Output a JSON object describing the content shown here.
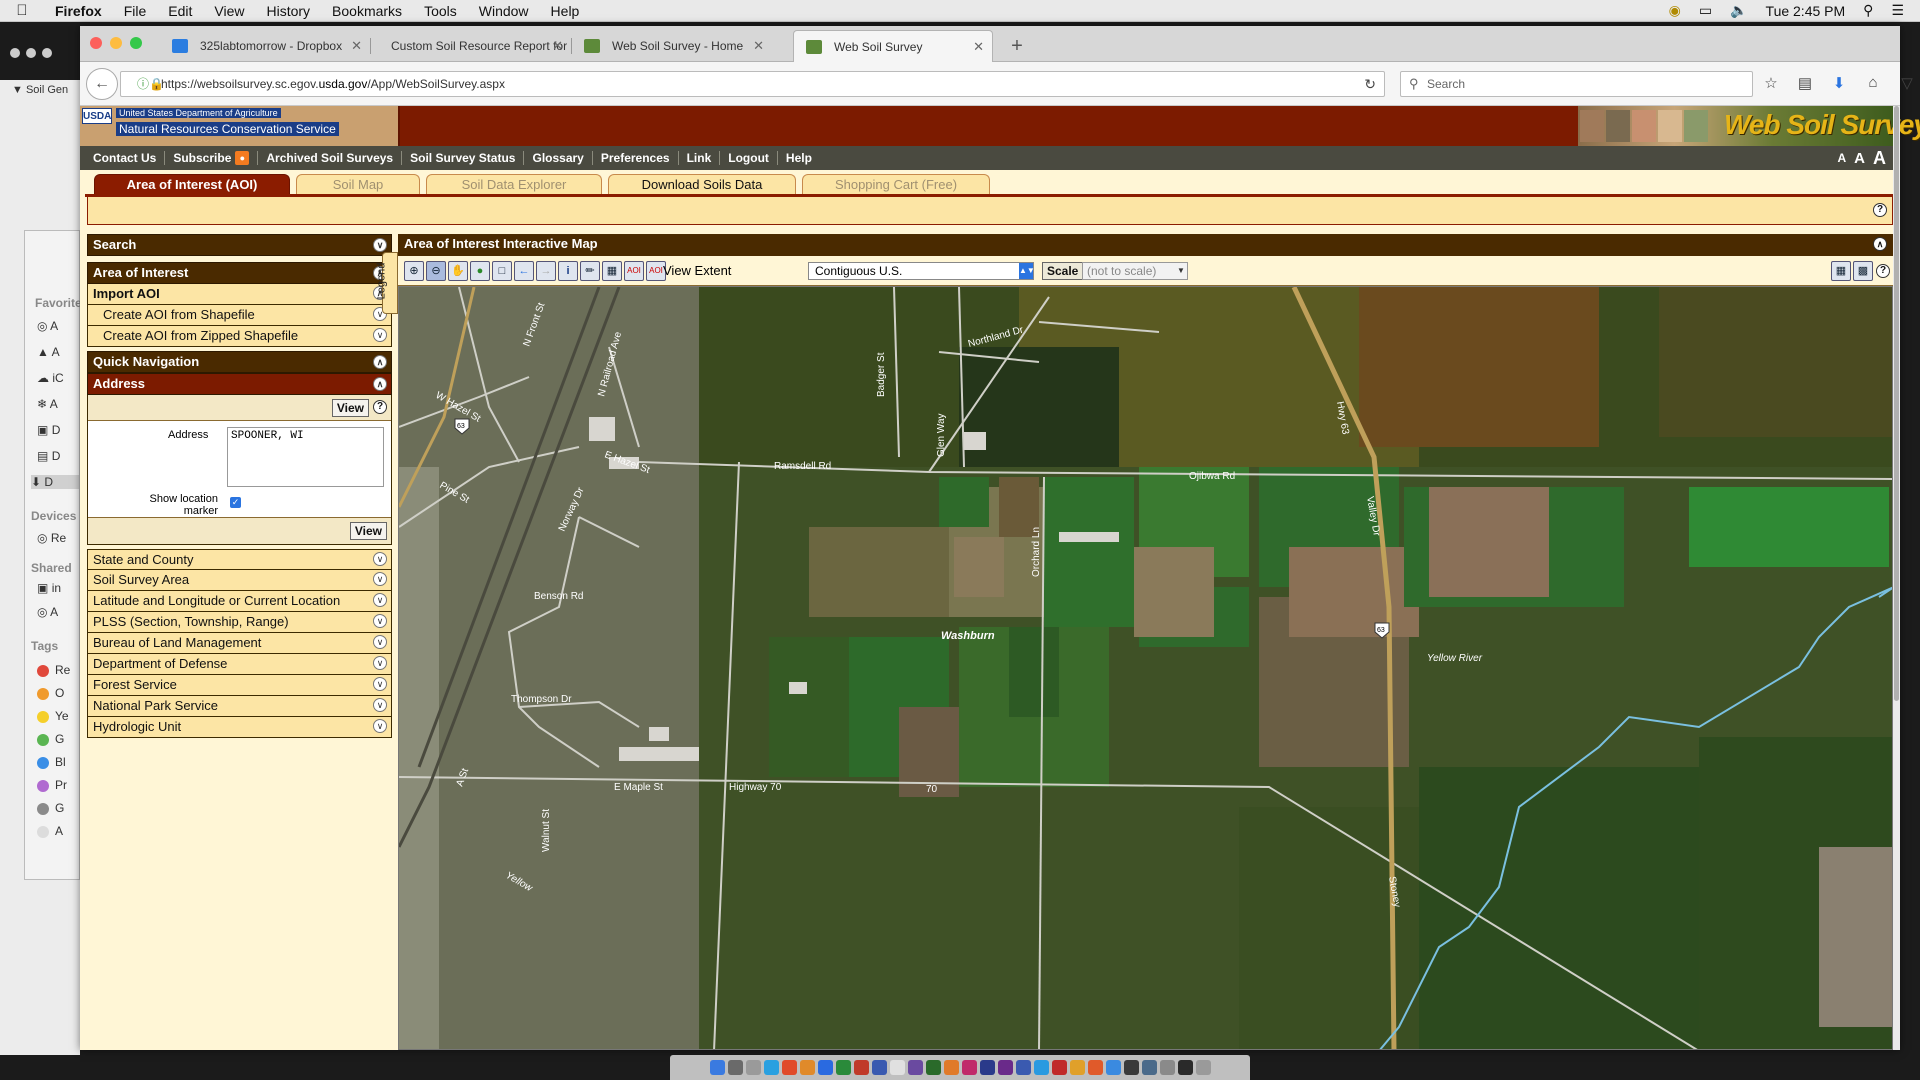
{
  "menubar": {
    "app": "Firefox",
    "items": [
      "File",
      "Edit",
      "View",
      "History",
      "Bookmarks",
      "Tools",
      "Window",
      "Help"
    ],
    "clock": "Tue 2:45 PM"
  },
  "background_window": {
    "title": "Soil Gen",
    "sidebar": {
      "favorites_label": "Favorite",
      "devices_label": "Devices",
      "shared_label": "Shared",
      "tags_label": "Tags",
      "favorites": [
        "A",
        "A",
        "iC",
        "A",
        "D",
        "D",
        "D"
      ],
      "devices": [
        "Re"
      ],
      "shared": [
        "in",
        "A"
      ],
      "tags": [
        {
          "label": "Re",
          "color": "#e0483b"
        },
        {
          "label": "O",
          "color": "#f09a2c"
        },
        {
          "label": "Ye",
          "color": "#f5cf2a"
        },
        {
          "label": "G",
          "color": "#5ab552"
        },
        {
          "label": "Bl",
          "color": "#3a8ee6"
        },
        {
          "label": "Pr",
          "color": "#b06ad0"
        },
        {
          "label": "G",
          "color": "#8a8a8a"
        },
        {
          "label": "A",
          "color": "#dcdcdc"
        }
      ]
    }
  },
  "browser": {
    "tabs": [
      {
        "label": "325labtomorrow - Dropbox",
        "icon": "dropbox-icon",
        "active": false
      },
      {
        "label": "Custom Soil Resource Report for",
        "icon": "none",
        "active": false
      },
      {
        "label": "Web Soil Survey - Home",
        "icon": "usda-icon",
        "active": false
      },
      {
        "label": "Web Soil Survey",
        "icon": "usda-icon",
        "active": true
      }
    ],
    "url_prefix": "https://websoilsurvey.sc.egov.",
    "url_domain": "usda.gov",
    "url_suffix": "/App/WebSoilSurvey.aspx",
    "search_placeholder": "Search"
  },
  "site": {
    "usda_badge": "USDA",
    "agency_line1": "United States Department of Agriculture",
    "agency_line2": "Natural Resources Conservation Service",
    "banner_title": "Web Soil Survey",
    "topnav": [
      "Contact Us",
      "Subscribe",
      "Archived Soil Surveys",
      "Soil Survey Status",
      "Glossary",
      "Preferences",
      "Link",
      "Logout",
      "Help"
    ],
    "font_sizes": [
      "A",
      "A",
      "A"
    ],
    "main_tabs": [
      {
        "label": "Area of Interest (AOI)",
        "state": "active"
      },
      {
        "label": "Soil Map",
        "state": "disabled"
      },
      {
        "label": "Soil Data Explorer",
        "state": "disabled"
      },
      {
        "label": "Download Soils Data",
        "state": "enabled"
      },
      {
        "label": "Shopping Cart (Free)",
        "state": "disabled"
      }
    ]
  },
  "left_panel": {
    "search": "Search",
    "aoi": "Area of Interest",
    "import_aoi": "Import AOI",
    "import_items": [
      "Create AOI from Shapefile",
      "Create AOI from Zipped Shapefile"
    ],
    "quick_nav": "Quick Navigation",
    "address_header": "Address",
    "view_label": "View",
    "address_label": "Address",
    "address_value": "SPOONER, WI",
    "marker_label_1": "Show location",
    "marker_label_2": "marker",
    "marker_checked": true,
    "nav_items": [
      "State and County",
      "Soil Survey Area",
      "Latitude and Longitude or Current Location",
      "PLSS (Section, Township, Range)",
      "Bureau of Land Management",
      "Department of Defense",
      "Forest Service",
      "National Park Service",
      "Hydrologic Unit"
    ]
  },
  "map": {
    "title": "Area of Interest Interactive Map",
    "legend_label": "Legend",
    "view_extent_label": "View Extent",
    "view_extent_value": "Contiguous U.S.",
    "scale_label": "Scale",
    "scale_value": "(not to scale)",
    "labels": {
      "hwy63_a": "63",
      "hwy63_b": "63",
      "hwy63_road": "Hwy 63",
      "cth70": "70",
      "washburn": "Washburn",
      "yellow_river": "Yellow River",
      "yellow": "Yellow",
      "w_hazel": "W Hazel St",
      "n_front": "N Front St",
      "n_railroad": "N Railroad Ave",
      "pine": "Pine St",
      "e_hazel": "E Hazel St",
      "ramsdell": "Ramsdell Rd",
      "ojibwa": "Ojibwa Rd",
      "northland": "Northland Dr",
      "badger": "Badger St",
      "glen": "Glen Way",
      "orchard": "Orchard Ln",
      "norway": "Norway Dr",
      "benson": "Benson Rd",
      "thompson": "Thompson Dr",
      "e_maple": "E Maple St",
      "highway": "Highway 70",
      "walnut": "Walnut St",
      "a_st": "A St",
      "valley": "Valley Dr",
      "stoney": "Stoney"
    }
  },
  "colors": {
    "usda_red": "#7c1b00",
    "panel_brown": "#4a2a00",
    "panel_fill": "#fce5a5",
    "page_fill": "#fff6d6"
  }
}
